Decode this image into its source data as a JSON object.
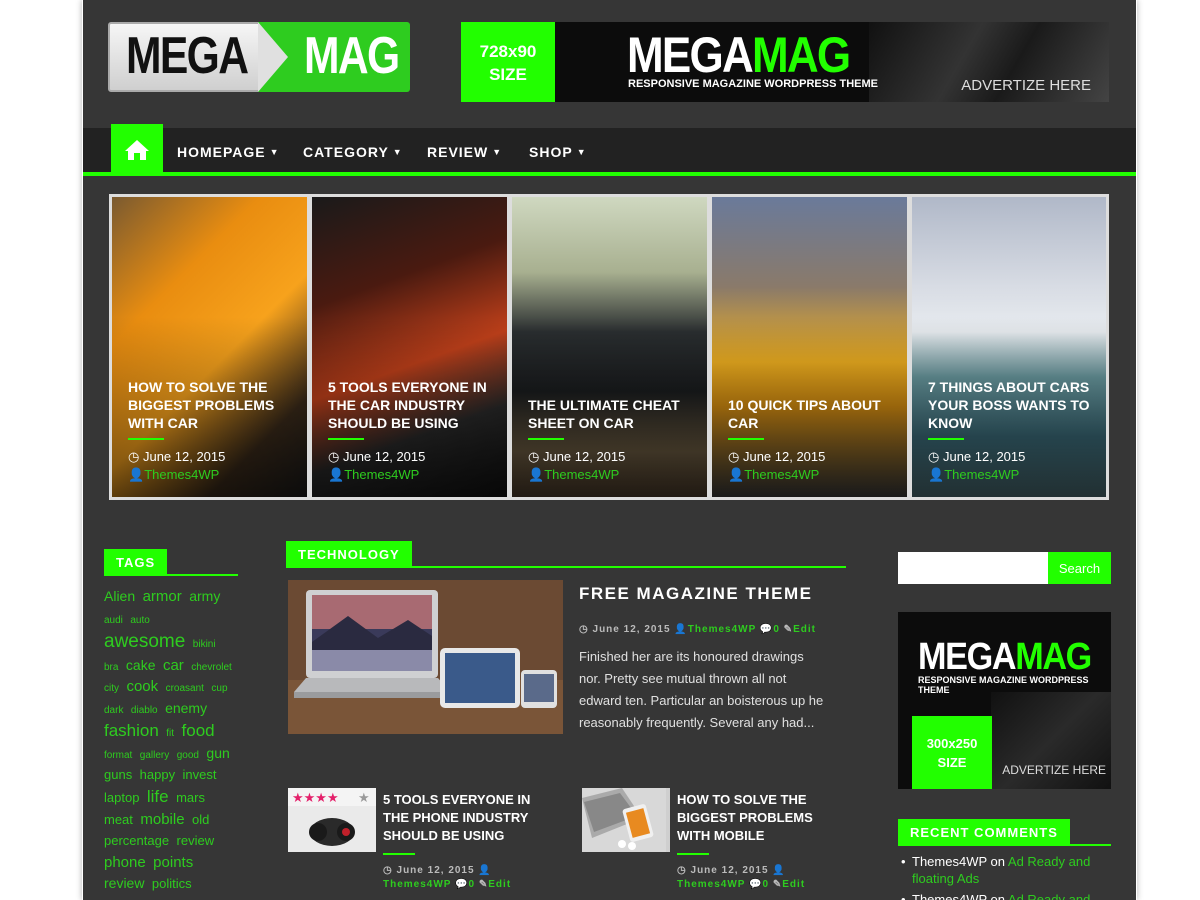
{
  "header": {
    "logo_left": "MEGA",
    "logo_right": "MAG",
    "banner": {
      "size_line1": "728x90",
      "size_line2": "SIZE",
      "brand_a": "MEGA",
      "brand_b": "MAG",
      "tagline": "RESPONSIVE MAGAZINE WORDPRESS THEME",
      "advertize": "ADVERTIZE HERE"
    }
  },
  "nav": {
    "items": [
      {
        "label": "HOMEPAGE"
      },
      {
        "label": "CATEGORY"
      },
      {
        "label": "REVIEW"
      },
      {
        "label": "SHOP"
      }
    ]
  },
  "slider": {
    "slides": [
      {
        "title": "HOW TO SOLVE THE BIGGEST PROBLEMS WITH CAR",
        "date": "June 12, 2015",
        "author": "Themes4WP"
      },
      {
        "title": "5 TOOLS EVERYONE IN THE CAR INDUSTRY SHOULD BE USING",
        "date": "June 12, 2015",
        "author": "Themes4WP"
      },
      {
        "title": "THE ULTIMATE CHEAT SHEET ON CAR",
        "date": "June 12, 2015",
        "author": "Themes4WP"
      },
      {
        "title": "10 QUICK TIPS ABOUT CAR",
        "date": "June 12, 2015",
        "author": "Themes4WP"
      },
      {
        "title": "7 THINGS ABOUT CARS YOUR BOSS WANTS TO KNOW",
        "date": "June 12, 2015",
        "author": "Themes4WP"
      }
    ]
  },
  "tags_widget": {
    "title": "TAGS",
    "tags": [
      {
        "t": "Alien",
        "s": 14
      },
      {
        "t": "armor",
        "s": 15
      },
      {
        "t": "army",
        "s": 14
      },
      {
        "t": "audi",
        "s": 10
      },
      {
        "t": "auto",
        "s": 10
      },
      {
        "t": "awesome",
        "s": 19
      },
      {
        "t": "bikini",
        "s": 10
      },
      {
        "t": "bra",
        "s": 10
      },
      {
        "t": "cake",
        "s": 14
      },
      {
        "t": "car",
        "s": 15
      },
      {
        "t": "chevrolet",
        "s": 10
      },
      {
        "t": "city",
        "s": 10
      },
      {
        "t": "cook",
        "s": 15
      },
      {
        "t": "croasant",
        "s": 10
      },
      {
        "t": "cup",
        "s": 10
      },
      {
        "t": "dark",
        "s": 10
      },
      {
        "t": "diablo",
        "s": 10
      },
      {
        "t": "enemy",
        "s": 14
      },
      {
        "t": "fashion",
        "s": 17
      },
      {
        "t": "fit",
        "s": 10
      },
      {
        "t": "food",
        "s": 17
      },
      {
        "t": "format",
        "s": 10
      },
      {
        "t": "gallery",
        "s": 10
      },
      {
        "t": "good",
        "s": 10
      },
      {
        "t": "gun",
        "s": 14
      },
      {
        "t": "guns",
        "s": 13
      },
      {
        "t": "happy",
        "s": 13
      },
      {
        "t": "invest",
        "s": 13
      },
      {
        "t": "laptop",
        "s": 13
      },
      {
        "t": "life",
        "s": 17
      },
      {
        "t": "mars",
        "s": 13
      },
      {
        "t": "meat",
        "s": 13
      },
      {
        "t": "mobile",
        "s": 15
      },
      {
        "t": "old",
        "s": 13
      },
      {
        "t": "percentage",
        "s": 13
      },
      {
        "t": "review",
        "s": 13
      },
      {
        "t": "phone",
        "s": 15
      },
      {
        "t": "points",
        "s": 15
      },
      {
        "t": "review",
        "s": 14
      },
      {
        "t": "politics",
        "s": 13
      }
    ]
  },
  "technology": {
    "section_title": "TECHNOLOGY",
    "featured": {
      "title": "FREE MAGAZINE THEME",
      "date": "June 12, 2015",
      "author": "Themes4WP",
      "comments": "0",
      "edit": "Edit",
      "excerpt": "Finished her are its honoured drawings nor. Pretty see mutual thrown all not edward ten. Particular an boisterous up he reasonably frequently. Several any had..."
    },
    "small_posts": [
      {
        "title": "5 TOOLS EVERYONE IN THE PHONE INDUSTRY SHOULD BE USING",
        "date": "June 12, 2015",
        "author": "Themes4WP",
        "comments": "0",
        "edit": "Edit"
      },
      {
        "title": "HOW TO SOLVE THE BIGGEST PROBLEMS WITH MOBILE",
        "date": "June 12, 2015",
        "author": "Themes4WP",
        "comments": "0",
        "edit": "Edit"
      }
    ]
  },
  "search": {
    "placeholder": "",
    "button": "Search"
  },
  "ad_300": {
    "brand_a": "MEGA",
    "brand_b": "MAG",
    "tagline": "RESPONSIVE MAGAZINE WORDPRESS THEME",
    "size_line1": "300x250",
    "size_line2": "SIZE",
    "advertize": "ADVERTIZE HERE"
  },
  "recent_comments": {
    "title": "RECENT COMMENTS",
    "items": [
      {
        "author": "Themes4WP",
        "on": "on",
        "link": "Ad Ready and floating Ads"
      },
      {
        "author": "Themes4WP",
        "on": "on",
        "link": "Ad Ready and"
      }
    ]
  },
  "colors": {
    "accent": "#22ff00",
    "link": "#2ecc1f",
    "page_bg": "#363636",
    "nav_bg": "#222222"
  }
}
